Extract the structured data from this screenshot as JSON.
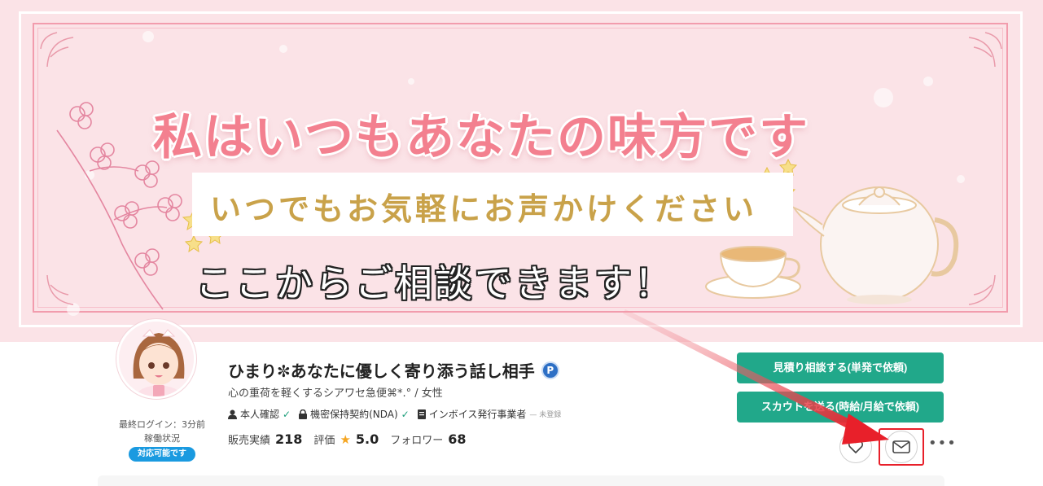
{
  "banner": {
    "headline": "私はいつもあなたの味方です",
    "subline": "いつでもお気軽にお声かけください",
    "callout": "ここからご相談できます！"
  },
  "profile": {
    "last_login": "最終ログイン：3分前",
    "work_status_label": "稼働状況",
    "status_badge": "対応可能です",
    "display_name": "ひまり✼あなたに優しく寄り添う話し相手",
    "premium_badge": "P",
    "tagline": "心の重荷を軽くするシアワセ急便⌘*.° / 女性",
    "verifications": [
      {
        "label": "本人確認",
        "icon": "person-icon",
        "status": "check-icon"
      },
      {
        "label": "機密保持契約(NDA)",
        "icon": "lock-icon",
        "status": "check-icon"
      },
      {
        "label": "インボイス発行事業者",
        "icon": "document-icon",
        "note": "— 未登録"
      }
    ],
    "stats": {
      "sales_label": "販売実績",
      "sales_value": "218",
      "rating_label": "評価",
      "rating_value": "5.0",
      "followers_label": "フォロワー",
      "followers_value": "68"
    }
  },
  "actions": {
    "estimate_label": "見積り相談する(単発で依頼)",
    "scout_label": "スカウトを送る(時給/月給で依頼)",
    "favorite_icon": "heart-icon",
    "message_icon": "mail-icon",
    "more_label": "•••"
  },
  "colors": {
    "banner_bg": "#fbe3e7",
    "headline": "#f3808f",
    "subline": "#c9a24a",
    "primary_button": "#21a88a",
    "status_badge": "#1a9ae0",
    "highlight": "#e8202a"
  }
}
